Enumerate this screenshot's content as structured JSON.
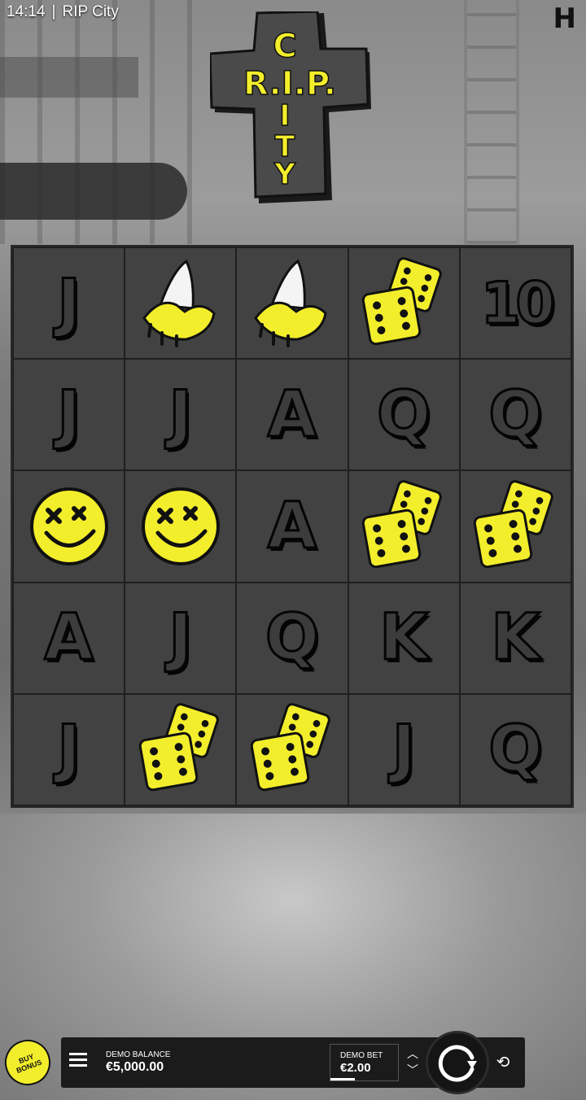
{
  "status_bar": {
    "time": "14:14",
    "separator": "|",
    "title": "RIP City"
  },
  "provider_logo": "H",
  "logo": {
    "cross_text_vertical": [
      "C",
      "I",
      "T",
      "Y"
    ],
    "cross_text_horizontal": "R.I.P."
  },
  "grid": {
    "rows": [
      [
        {
          "type": "letter",
          "label": "J"
        },
        {
          "type": "banana"
        },
        {
          "type": "banana"
        },
        {
          "type": "dice"
        },
        {
          "type": "letter",
          "label": "10"
        }
      ],
      [
        {
          "type": "letter",
          "label": "J"
        },
        {
          "type": "letter",
          "label": "J"
        },
        {
          "type": "letter",
          "label": "A"
        },
        {
          "type": "letter",
          "label": "Q"
        },
        {
          "type": "letter",
          "label": "Q"
        }
      ],
      [
        {
          "type": "smiley"
        },
        {
          "type": "smiley"
        },
        {
          "type": "letter",
          "label": "A"
        },
        {
          "type": "dice"
        },
        {
          "type": "dice"
        }
      ],
      [
        {
          "type": "letter",
          "label": "A"
        },
        {
          "type": "letter",
          "label": "J"
        },
        {
          "type": "letter",
          "label": "Q"
        },
        {
          "type": "letter",
          "label": "K"
        },
        {
          "type": "letter",
          "label": "K"
        }
      ],
      [
        {
          "type": "letter",
          "label": "J"
        },
        {
          "type": "dice"
        },
        {
          "type": "dice"
        },
        {
          "type": "letter",
          "label": "J"
        },
        {
          "type": "letter",
          "label": "Q"
        }
      ]
    ]
  },
  "buy_bonus": {
    "label_line1": "BUY",
    "label_line2": "BONUS"
  },
  "balance": {
    "label": "DEMO BALANCE",
    "value": "€5,000.00"
  },
  "bet": {
    "label": "DEMO BET",
    "value": "€2.00"
  },
  "icons": {
    "menu": "hamburger-icon",
    "spin": "spin-icon",
    "autoplay": "autoplay-icon",
    "bet_up": "chevron-up-icon",
    "bet_down": "chevron-down-icon"
  },
  "colors": {
    "symbol_yellow": "#f3ee2b",
    "cell_bg": "#424242",
    "bar_bg": "#1b1b1b"
  }
}
